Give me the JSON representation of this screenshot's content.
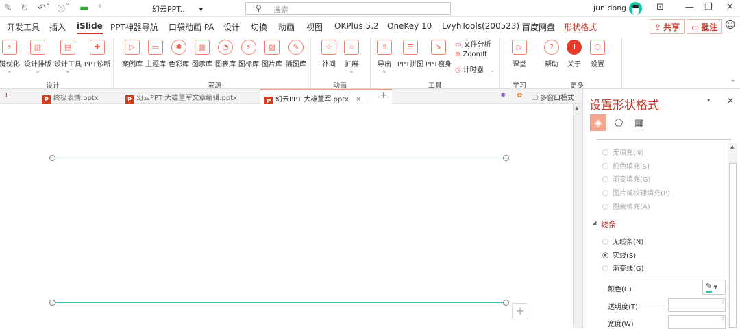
{
  "titlebar": {
    "doc_title": "幻云PPT...",
    "doc_title_chevron": "▾",
    "search_placeholder": "搜索",
    "user_name": "jun dong"
  },
  "tabs": [
    "开发工具",
    "插入",
    "iSlide",
    "PPT神器导航",
    "口袋动画 PA",
    "设计",
    "切换",
    "动画",
    "视图",
    "OKPlus 5.2",
    "OneKey 10",
    "LvyhTools(200523)",
    "百度网盘",
    "形状格式"
  ],
  "active_tab": "iSlide",
  "contextual_tab": "形状格式",
  "share_label": "共享",
  "comment_label": "批注",
  "ribbon": {
    "buttons": [
      {
        "label": "键优化",
        "icon": "lightning-screen-icon",
        "chev": true
      },
      {
        "label": "设计排版",
        "icon": "layout-icon",
        "chev": true
      },
      {
        "label": "设计工具",
        "icon": "design-tool-icon",
        "chev": true
      },
      {
        "label": "PPT诊断",
        "icon": "first-aid-icon",
        "chev": false
      },
      {
        "label": "案例库",
        "icon": "presentation-icon",
        "chev": false
      },
      {
        "label": "主题库",
        "icon": "theme-icon",
        "chev": false
      },
      {
        "label": "色彩库",
        "icon": "palette-icon",
        "chev": false
      },
      {
        "label": "图示库",
        "icon": "diagram-icon",
        "chev": false
      },
      {
        "label": "图表库",
        "icon": "pie-chart-icon",
        "chev": false
      },
      {
        "label": "图标库",
        "icon": "icon-library-icon",
        "chev": false
      },
      {
        "label": "图片库",
        "icon": "picture-icon",
        "chev": false
      },
      {
        "label": "插图库",
        "icon": "brush-icon",
        "chev": false
      },
      {
        "label": "补间",
        "icon": "star-icon",
        "chev": false
      },
      {
        "label": "扩展",
        "icon": "star-extend-icon",
        "chev": true
      },
      {
        "label": "导出",
        "icon": "export-folder-icon",
        "chev": true
      },
      {
        "label": "PPT拼图",
        "icon": "collage-icon",
        "chev": false
      },
      {
        "label": "PPT瘦身",
        "icon": "compress-icon",
        "chev": false
      },
      {
        "label": "课堂",
        "icon": "classroom-icon",
        "chev": false
      },
      {
        "label": "帮助",
        "icon": "help-icon",
        "chev": false
      },
      {
        "label": "关于",
        "icon": "info-icon",
        "chev": false
      },
      {
        "label": "设置",
        "icon": "settings-hexagon-icon",
        "chev": false
      }
    ],
    "small": [
      {
        "label": "文件分析",
        "icon": "file-analysis-icon"
      },
      {
        "label": "ZoomIt",
        "icon": "zoom-icon"
      },
      {
        "label": "计时器",
        "icon": "timer-icon"
      }
    ],
    "groups": [
      "设计",
      "资源",
      "动画",
      "工具",
      "学习",
      "更多"
    ]
  },
  "doc_tabs": {
    "index": "1",
    "items": [
      "终极表情.pptx",
      "幻云PPT 大雄董军文章编辑.pptx",
      "幻云PPT 大雄董军.pptx"
    ],
    "multi_window": "多窗口模式"
  },
  "pane": {
    "title": "设置形状格式",
    "fill_options": [
      "无填充(N)",
      "纯色填充(S)",
      "渐变填充(G)",
      "图片或纹理填充(P)",
      "图案填充(A)"
    ],
    "line_section": "线条",
    "line_options": [
      "无线条(N)",
      "实线(S)",
      "渐变线(G)"
    ],
    "line_selected": "实线(S)",
    "color_label": "颜色(C)",
    "transparency_label": "透明度(T)",
    "width_label": "宽度(W)",
    "line_color": "#2ec4a6"
  }
}
